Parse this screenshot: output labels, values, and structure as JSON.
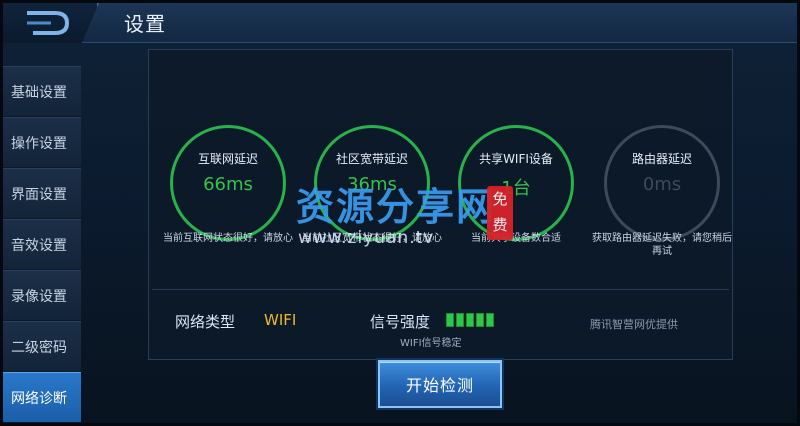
{
  "header": {
    "title": "设置"
  },
  "sidebar": {
    "items": [
      {
        "label": "基础设置",
        "active": false
      },
      {
        "label": "操作设置",
        "active": false
      },
      {
        "label": "界面设置",
        "active": false
      },
      {
        "label": "音效设置",
        "active": false
      },
      {
        "label": "录像设置",
        "active": false
      },
      {
        "label": "二级密码",
        "active": false
      },
      {
        "label": "网络诊断",
        "active": true
      }
    ]
  },
  "diagnostics": [
    {
      "title": "互联网延迟",
      "value": "66ms",
      "note": "当前互联网状态很好，请放心",
      "status": "good"
    },
    {
      "title": "社区宽带延迟",
      "value": "36ms",
      "note": "当前社区宽带状态很好，请放心",
      "status": "good"
    },
    {
      "title": "共享WIFI设备",
      "value": "1台",
      "note": "当前共享设备数合适",
      "status": "good"
    },
    {
      "title": "路由器延迟",
      "value": "0ms",
      "note": "获取路由器延迟失败，请您稍后再试",
      "status": "unavailable"
    }
  ],
  "network_info": {
    "type_label": "网络类型",
    "type_value": "WIFI",
    "signal_label": "信号强度",
    "signal_bars_filled": 5,
    "signal_bars_total": 5,
    "signal_note": "WIFI信号稳定",
    "provider_note": "腾讯智营网优提供"
  },
  "actions": {
    "start_label": "开始检测"
  },
  "watermark": {
    "text": "资源分享网",
    "badge": "免费",
    "url": "www.ziyuan.tv"
  },
  "colors": {
    "good": "#35c24f",
    "unavailable": "#3e4a58",
    "accent": "#2a78c9",
    "wifi_value": "#f1b82e"
  }
}
